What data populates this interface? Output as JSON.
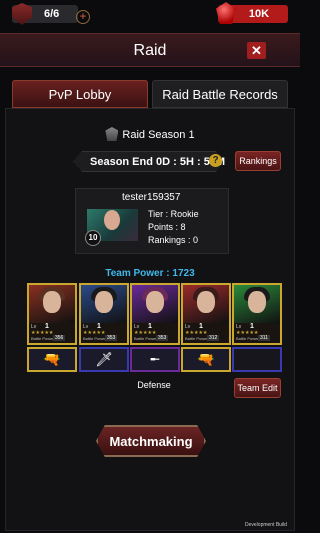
{
  "topbar": {
    "stamina_icon": "shield-icon",
    "stamina": "6/6",
    "stamina_add": "+",
    "gems_icon": "ruby-gem-icon",
    "gems": "10K"
  },
  "header": {
    "title": "Raid",
    "close": "✕"
  },
  "tabs": [
    {
      "label": "PvP Lobby",
      "active": true
    },
    {
      "label": "Raid Battle Records",
      "active": false
    }
  ],
  "season": {
    "title": "Raid Season 1",
    "end": "Season End 0D : 5H : 55M",
    "help": "?",
    "rankings_button": "Rankings"
  },
  "profile": {
    "name": "tester159357",
    "level": "10",
    "tier": "Tier : Rookie",
    "points": "Points : 8",
    "rankings": "Rankings : 0"
  },
  "team_power": "Team Power : 1723",
  "heroes": [
    {
      "lv": "Lv",
      "level": "1",
      "stars": "★★★★★",
      "bp_label": "Battle Power",
      "bp": "356",
      "bg": "#8a3020",
      "hair": "#5a3020"
    },
    {
      "lv": "Lv",
      "level": "1",
      "stars": "★★★★★",
      "bp_label": "Battle Power",
      "bp": "353",
      "bg": "#2a4a8a",
      "hair": "#1a1a1a"
    },
    {
      "lv": "Lv",
      "level": "1",
      "stars": "★★★★★",
      "bp_label": "Battle Power",
      "bp": "353",
      "bg": "#6a2a9a",
      "hair": "#6a2a5a"
    },
    {
      "lv": "Lv",
      "level": "1",
      "stars": "★★★★★",
      "bp_label": "Battle Power",
      "bp": "312",
      "bg": "#9a2a2a",
      "hair": "#3a1a1a"
    },
    {
      "lv": "Lv",
      "level": "1",
      "stars": "★★★★★",
      "bp_label": "Battle Power",
      "bp": "311",
      "bg": "#2a8a3a",
      "hair": "#1a1a1a"
    }
  ],
  "weapons": [
    {
      "icon": "pistol-icon",
      "glyph": "🔫"
    },
    {
      "icon": "knife-icon",
      "glyph": "🗡"
    },
    {
      "icon": "sniper-rifle-icon",
      "glyph": "╾"
    },
    {
      "icon": "pistol-icon",
      "glyph": "🔫"
    },
    {
      "icon": "empty-slot-icon",
      "glyph": ""
    }
  ],
  "defense_label": "Defense",
  "team_edit_button": "Team Edit",
  "matchmaking_button": "Matchmaking",
  "dev_build": "Development Build"
}
